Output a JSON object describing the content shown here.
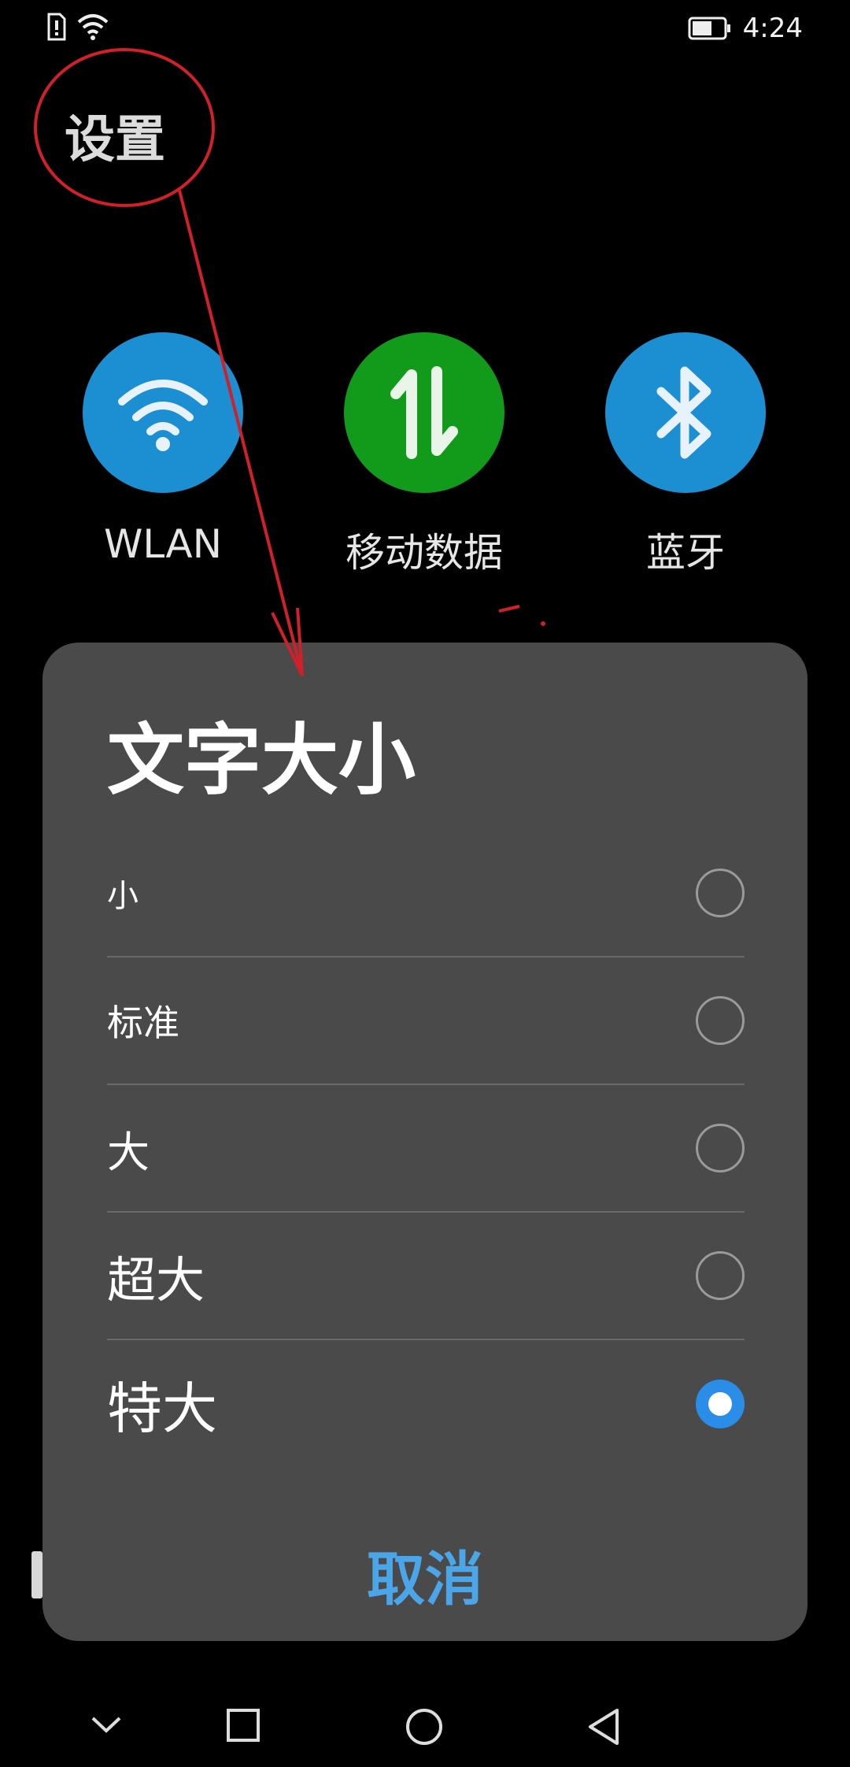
{
  "status_bar": {
    "time": "4:24",
    "icons": [
      "sim-alert-icon",
      "wifi-icon",
      "battery-icon"
    ]
  },
  "header": {
    "title": "设置"
  },
  "quick_toggles": [
    {
      "label": "WLAN",
      "icon": "wifi-icon",
      "color": "#1b8fd2"
    },
    {
      "label": "移动数据",
      "icon": "data-transfer-icon",
      "color": "#129a1a"
    },
    {
      "label": "蓝牙",
      "icon": "bluetooth-icon",
      "color": "#1b8fd2"
    }
  ],
  "dialog": {
    "title": "文字大小",
    "options": [
      {
        "label": "小",
        "selected": false
      },
      {
        "label": "标准",
        "selected": false
      },
      {
        "label": "大",
        "selected": false
      },
      {
        "label": "超大",
        "selected": false
      },
      {
        "label": "特大",
        "selected": true
      }
    ],
    "cancel_label": "取消"
  },
  "navbar": {
    "icons": [
      "chevron-down-icon",
      "recents-square-icon",
      "home-circle-icon",
      "back-triangle-icon"
    ]
  },
  "colors": {
    "accent": "#2a8ee8",
    "cancel_text": "#4aa6e8",
    "dialog_bg": "#4a4a4a",
    "annotation": "#d0202a"
  }
}
